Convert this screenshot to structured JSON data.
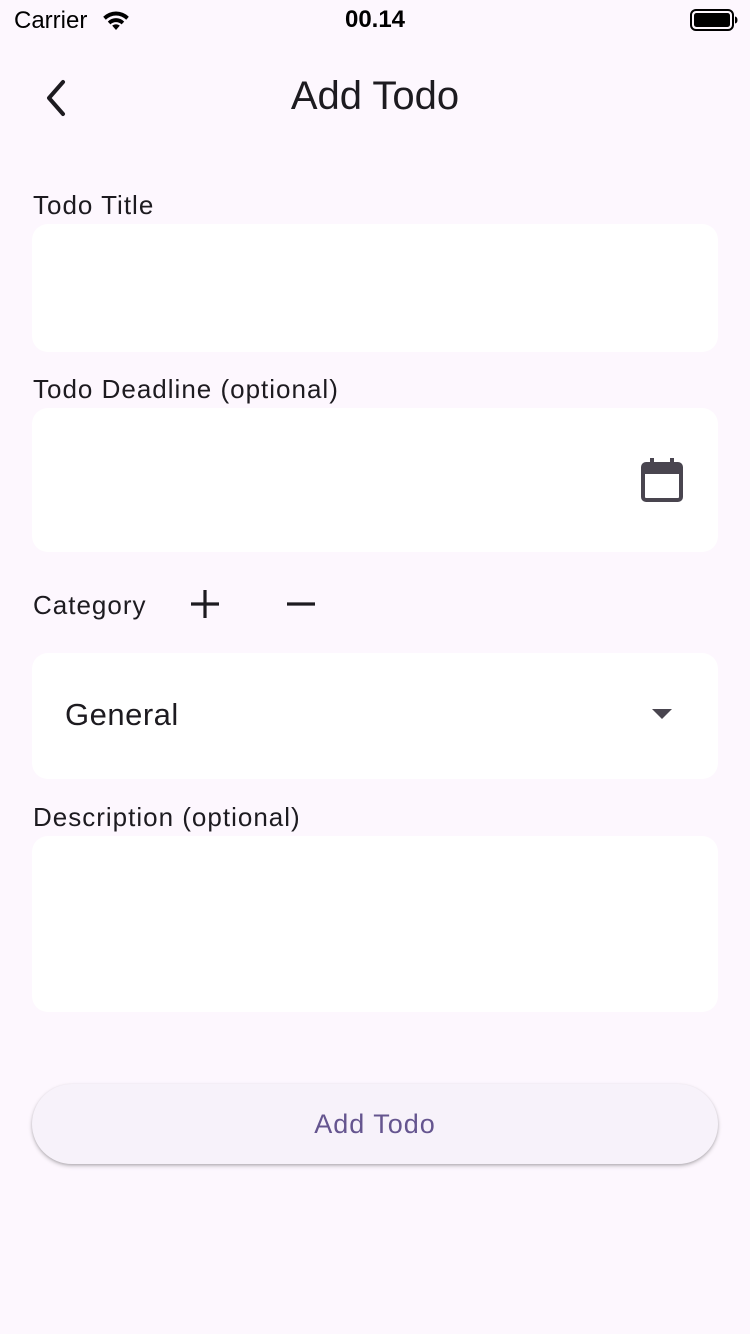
{
  "status_bar": {
    "carrier": "Carrier",
    "time": "00.14",
    "wifi_icon": "wifi-icon",
    "battery_icon": "battery-full-icon"
  },
  "app_bar": {
    "title": "Add Todo",
    "back_icon": "chevron-left-icon"
  },
  "form": {
    "title_label": "Todo Title",
    "title_value": "",
    "deadline_label": "Todo Deadline (optional)",
    "deadline_value": "",
    "deadline_icon": "calendar-icon",
    "category_label": "Category",
    "category_add_icon": "plus-icon",
    "category_remove_icon": "minus-icon",
    "category_selected": "General",
    "description_label": "Description (optional)",
    "description_value": "",
    "submit_label": "Add Todo"
  },
  "colors": {
    "background": "#fdf7fe",
    "field_background": "#ffffff",
    "button_background": "#f7f2fa",
    "button_text": "#65558f",
    "text": "#1d1b20"
  }
}
